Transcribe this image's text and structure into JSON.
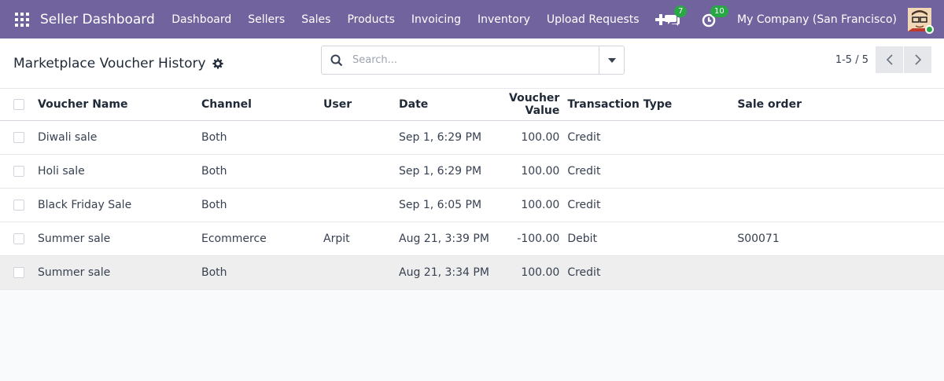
{
  "navbar": {
    "brand": "Seller Dashboard",
    "menu": [
      "Dashboard",
      "Sellers",
      "Sales",
      "Products",
      "Invoicing",
      "Inventory",
      "Upload Requests"
    ],
    "messages_count": "7",
    "activities_count": "10",
    "company": "My Company (San Francisco)",
    "color": "#71639e"
  },
  "control": {
    "title": "Marketplace Voucher History",
    "search_placeholder": "Search...",
    "pager": "1-5 / 5"
  },
  "table": {
    "headers": {
      "name": "Voucher Name",
      "channel": "Channel",
      "user": "User",
      "date": "Date",
      "value": "Voucher Value",
      "type": "Transaction Type",
      "order": "Sale order"
    },
    "rows": [
      {
        "name": "Diwali sale",
        "channel": "Both",
        "user": "",
        "date": "Sep 1, 6:29 PM",
        "value": "100.00",
        "type": "Credit",
        "order": ""
      },
      {
        "name": "Holi sale",
        "channel": "Both",
        "user": "",
        "date": "Sep 1, 6:29 PM",
        "value": "100.00",
        "type": "Credit",
        "order": ""
      },
      {
        "name": "Black Friday Sale",
        "channel": "Both",
        "user": "",
        "date": "Sep 1, 6:05 PM",
        "value": "100.00",
        "type": "Credit",
        "order": ""
      },
      {
        "name": "Summer sale",
        "channel": "Ecommerce",
        "user": "Arpit",
        "date": "Aug 21, 3:39 PM",
        "value": "-100.00",
        "type": "Debit",
        "order": "S00071"
      },
      {
        "name": "Summer sale",
        "channel": "Both",
        "user": "",
        "date": "Aug 21, 3:34 PM",
        "value": "100.00",
        "type": "Credit",
        "order": ""
      }
    ]
  }
}
